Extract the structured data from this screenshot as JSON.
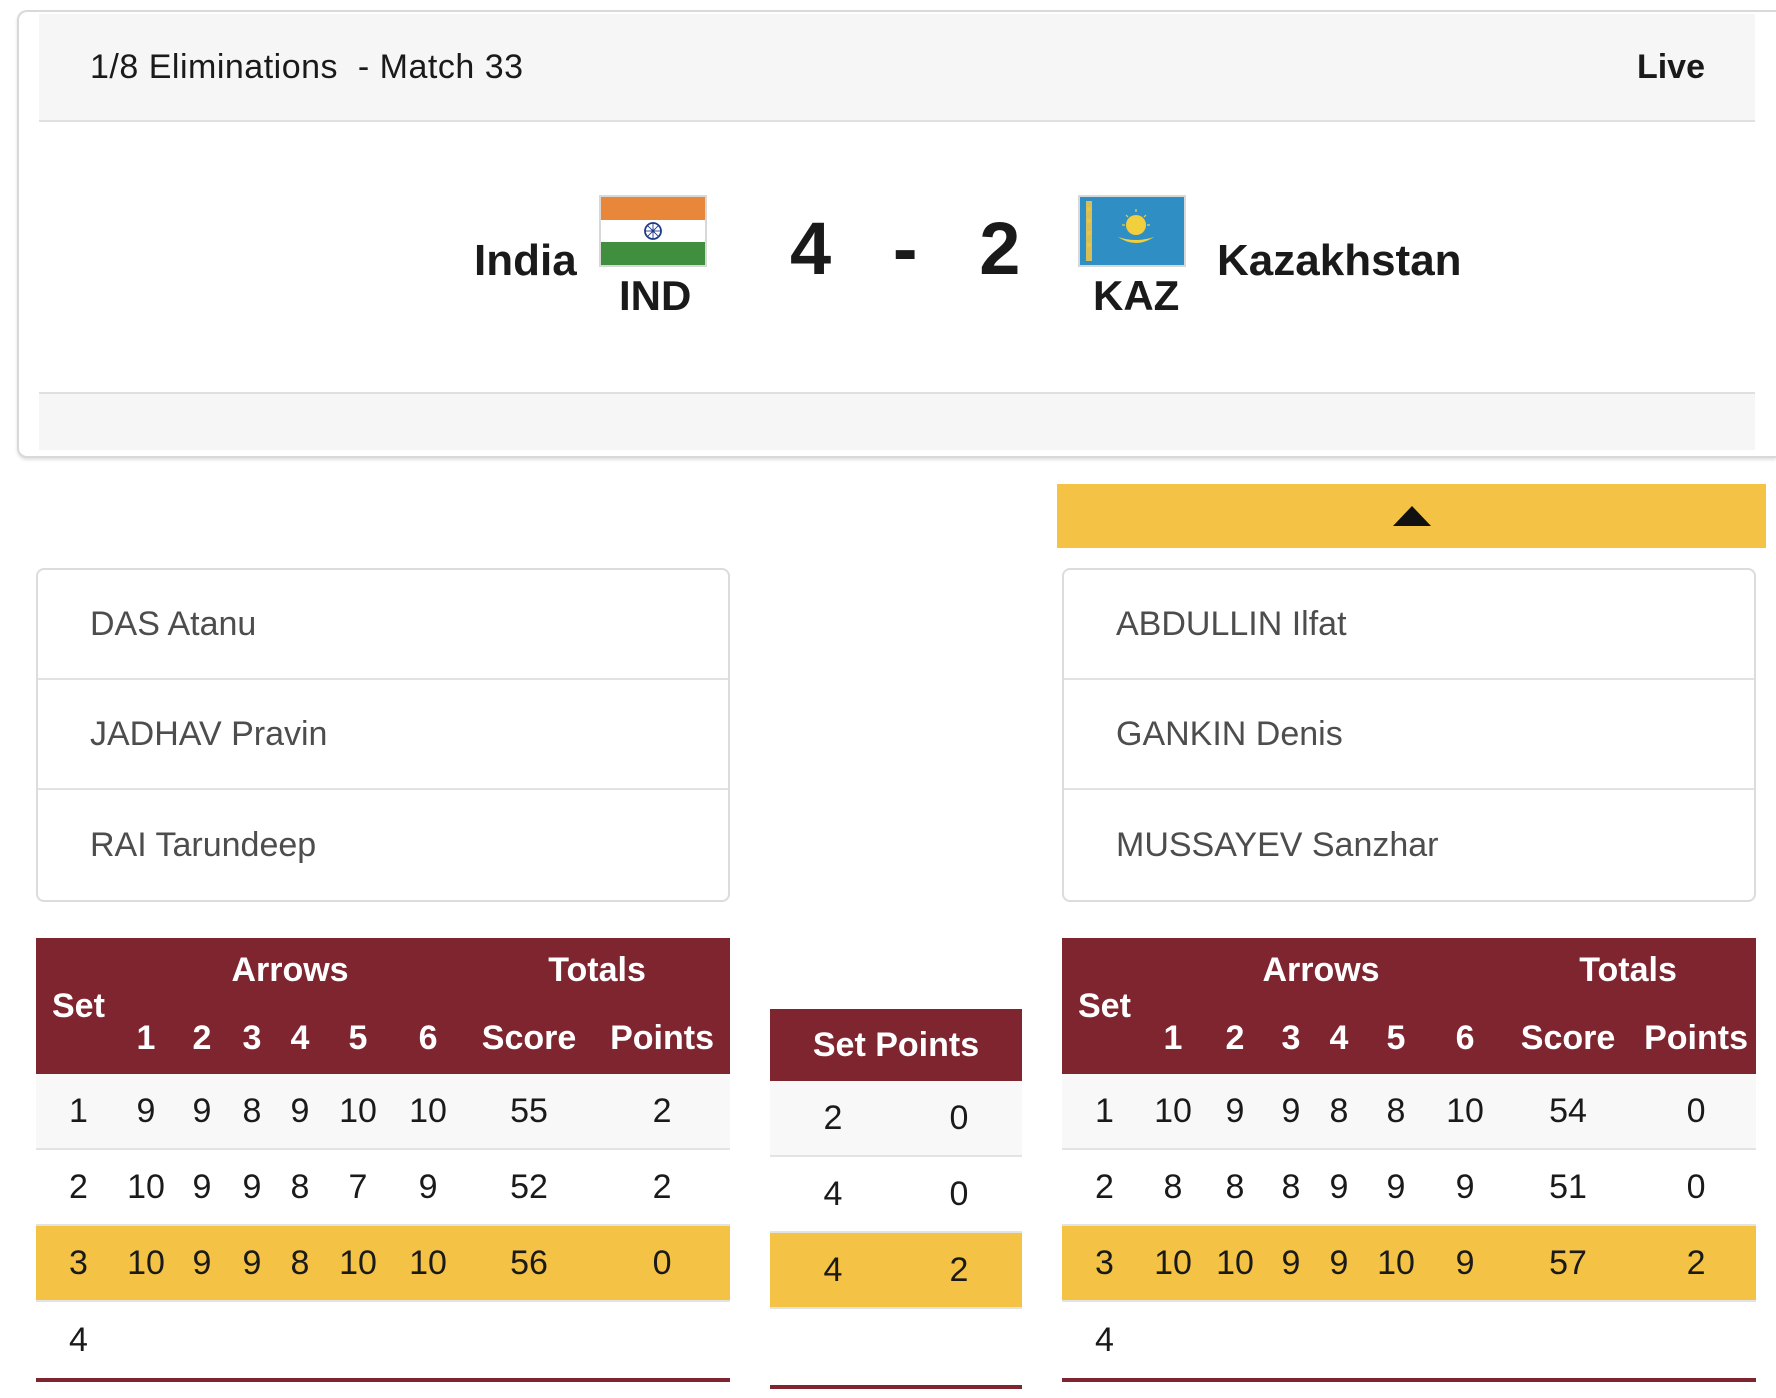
{
  "header": {
    "title": "1/8 Eliminations  - Match 33",
    "status": "Live"
  },
  "match": {
    "left_team": {
      "name": "India",
      "code": "IND",
      "flag_icon": "india-flag-icon"
    },
    "right_team": {
      "name": "Kazakhstan",
      "code": "KAZ",
      "flag_icon": "kazakhstan-flag-icon"
    },
    "score_left": "4",
    "score_separator": "-",
    "score_right": "2"
  },
  "expand_icon": "caret-up-icon",
  "rosters": {
    "left": [
      "DAS Atanu",
      "JADHAV Pravin",
      "RAI Tarundeep"
    ],
    "right": [
      "ABDULLIN Ilfat",
      "GANKIN Denis",
      "MUSSAYEV Sanzhar"
    ]
  },
  "table_headers": {
    "set": "Set",
    "arrows": "Arrows",
    "totals": "Totals",
    "arrow_numbers": [
      "1",
      "2",
      "3",
      "4",
      "5",
      "6"
    ],
    "score": "Score",
    "points": "Points",
    "set_points": "Set Points"
  },
  "left_sets": [
    {
      "set": "1",
      "arrows": [
        "9",
        "9",
        "8",
        "9",
        "10",
        "10"
      ],
      "score": "55",
      "points": "2"
    },
    {
      "set": "2",
      "arrows": [
        "10",
        "9",
        "9",
        "8",
        "7",
        "9"
      ],
      "score": "52",
      "points": "2"
    },
    {
      "set": "3",
      "arrows": [
        "10",
        "9",
        "9",
        "8",
        "10",
        "10"
      ],
      "score": "56",
      "points": "0"
    },
    {
      "set": "4",
      "arrows": [
        "",
        "",
        "",
        "",
        "",
        ""
      ],
      "score": "",
      "points": ""
    }
  ],
  "right_sets": [
    {
      "set": "1",
      "arrows": [
        "10",
        "9",
        "9",
        "8",
        "8",
        "10"
      ],
      "score": "54",
      "points": "0"
    },
    {
      "set": "2",
      "arrows": [
        "8",
        "8",
        "8",
        "9",
        "9",
        "9"
      ],
      "score": "51",
      "points": "0"
    },
    {
      "set": "3",
      "arrows": [
        "10",
        "10",
        "9",
        "9",
        "10",
        "9"
      ],
      "score": "57",
      "points": "2"
    },
    {
      "set": "4",
      "arrows": [
        "",
        "",
        "",
        "",
        "",
        ""
      ],
      "score": "",
      "points": ""
    }
  ],
  "set_points": [
    {
      "left": "2",
      "right": "0"
    },
    {
      "left": "4",
      "right": "0"
    },
    {
      "left": "4",
      "right": "2"
    },
    {
      "left": "",
      "right": ""
    }
  ],
  "highlighted_set": "3",
  "colors": {
    "header_maroon": "#7f2530",
    "highlight_yellow": "#f4c244",
    "row_alt": "#f8f8f8"
  }
}
